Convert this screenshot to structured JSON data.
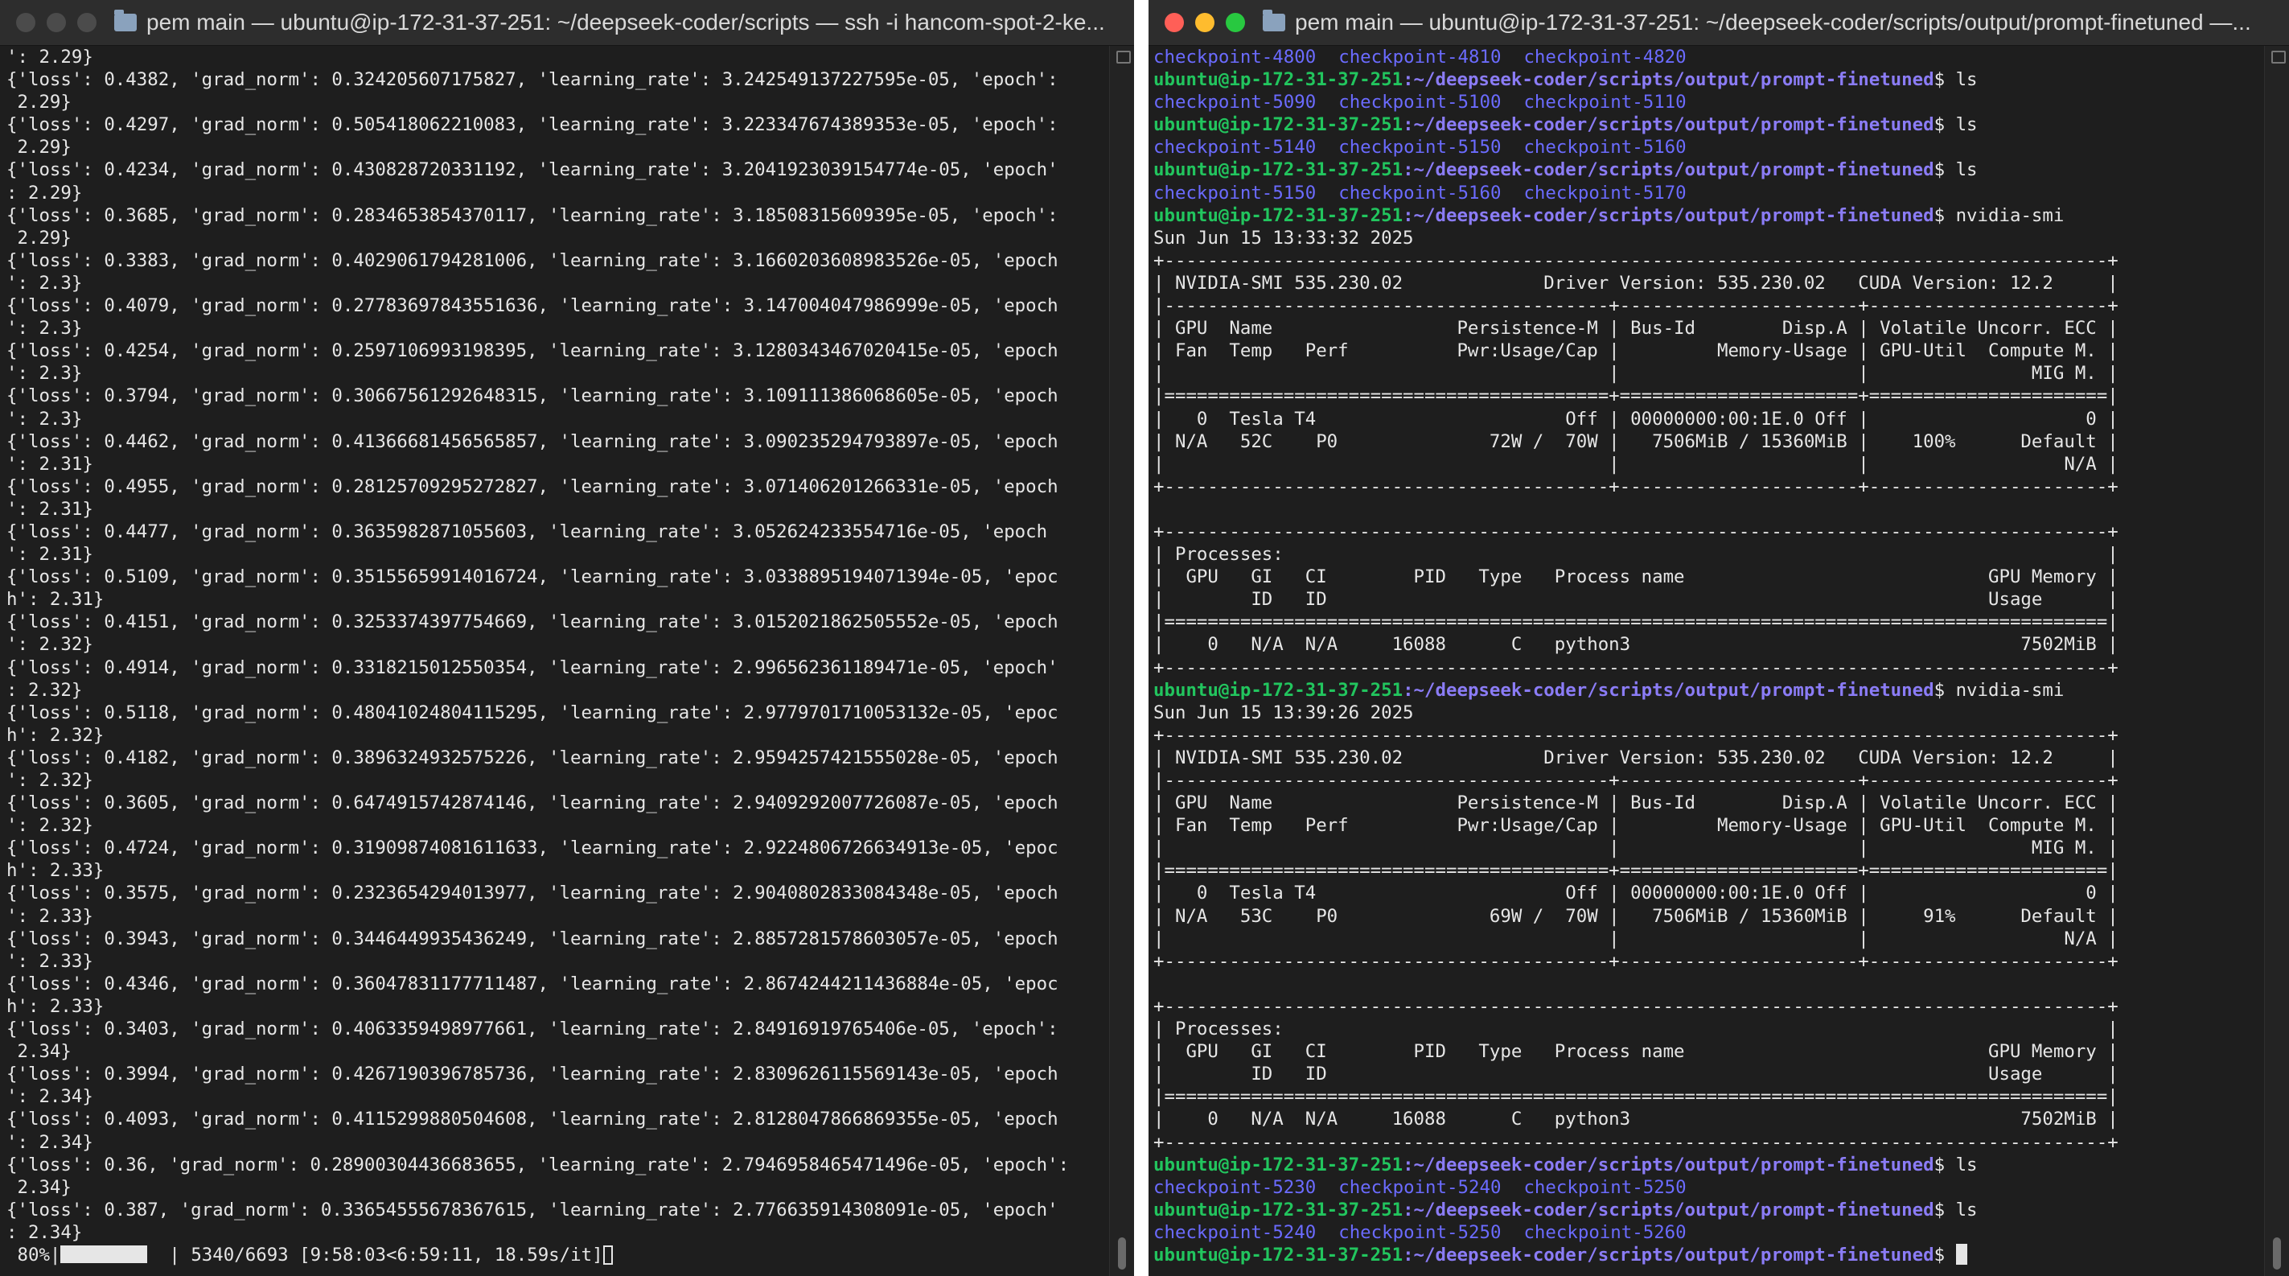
{
  "colors": {
    "close": "#ff5f57",
    "minimize": "#febc2e",
    "zoom": "#28c840",
    "prompt_user": "#22c55e",
    "prompt_path": "#8b7cf6",
    "checkpoint_dir": "#6b6bff"
  },
  "left_window": {
    "title": "pem main — ubuntu@ip-172-31-37-251: ~/deepseek-coder/scripts — ssh -i hancom-spot-2-ke...",
    "lines": [
      "': 2.29}",
      "{'loss': 0.4382, 'grad_norm': 0.324205607175827, 'learning_rate': 3.242549137227595e-05, 'epoch':",
      " 2.29}",
      "{'loss': 0.4297, 'grad_norm': 0.505418062210083, 'learning_rate': 3.223347674389353e-05, 'epoch':",
      " 2.29}",
      "{'loss': 0.4234, 'grad_norm': 0.430828720331192, 'learning_rate': 3.2041923039154774e-05, 'epoch'",
      ": 2.29}",
      "{'loss': 0.3685, 'grad_norm': 0.2834653854370117, 'learning_rate': 3.18508315609395e-05, 'epoch':",
      " 2.29}",
      "{'loss': 0.3383, 'grad_norm': 0.4029061794281006, 'learning_rate': 3.1660203608983526e-05, 'epoch",
      "': 2.3}",
      "{'loss': 0.4079, 'grad_norm': 0.27783697843551636, 'learning_rate': 3.147004047986999e-05, 'epoch",
      "': 2.3}",
      "{'loss': 0.4254, 'grad_norm': 0.2597106993198395, 'learning_rate': 3.1280343467020415e-05, 'epoch",
      "': 2.3}",
      "{'loss': 0.3794, 'grad_norm': 0.30667561292648315, 'learning_rate': 3.109111386068605e-05, 'epoch",
      "': 2.3}",
      "{'loss': 0.4462, 'grad_norm': 0.41366681456565857, 'learning_rate': 3.090235294793897e-05, 'epoch",
      "': 2.31}",
      "{'loss': 0.4955, 'grad_norm': 0.28125709295272827, 'learning_rate': 3.071406201266331e-05, 'epoch",
      "': 2.31}",
      "{'loss': 0.4477, 'grad_norm': 0.3635982871055603, 'learning_rate': 3.052624233554716e-05, 'epoch",
      "': 2.31}",
      "{'loss': 0.5109, 'grad_norm': 0.35155659914016724, 'learning_rate': 3.0338895194071394e-05, 'epoc",
      "h': 2.31}",
      "{'loss': 0.4151, 'grad_norm': 0.3253374397754669, 'learning_rate': 3.0152021862505552e-05, 'epoch",
      "': 2.32}",
      "{'loss': 0.4914, 'grad_norm': 0.3318215012550354, 'learning_rate': 2.996562361189471e-05, 'epoch'",
      ": 2.32}",
      "{'loss': 0.5118, 'grad_norm': 0.48041024804115295, 'learning_rate': 2.9779701710053132e-05, 'epoc",
      "h': 2.32}",
      "{'loss': 0.4182, 'grad_norm': 0.3896324932575226, 'learning_rate': 2.9594257421555028e-05, 'epoch",
      "': 2.32}",
      "{'loss': 0.3605, 'grad_norm': 0.6474915742874146, 'learning_rate': 2.9409292007726087e-05, 'epoch",
      "': 2.32}",
      "{'loss': 0.4724, 'grad_norm': 0.31909874081611633, 'learning_rate': 2.9224806726634913e-05, 'epoc",
      "h': 2.33}",
      "{'loss': 0.3575, 'grad_norm': 0.2323654294013977, 'learning_rate': 2.9040802833084348e-05, 'epoch",
      "': 2.33}",
      "{'loss': 0.3943, 'grad_norm': 0.3446449935436249, 'learning_rate': 2.8857281578603057e-05, 'epoch",
      "': 2.33}",
      "{'loss': 0.4346, 'grad_norm': 0.36047831177711487, 'learning_rate': 2.8674244211436884e-05, 'epoc",
      "h': 2.33}",
      "{'loss': 0.3403, 'grad_norm': 0.4063359498977661, 'learning_rate': 2.84916919765406e-05, 'epoch':",
      " 2.34}",
      "{'loss': 0.3994, 'grad_norm': 0.4267190396785736, 'learning_rate': 2.8309626115569143e-05, 'epoch",
      "': 2.34}",
      "{'loss': 0.4093, 'grad_norm': 0.4115299880504608, 'learning_rate': 2.8128047866869355e-05, 'epoch",
      "': 2.34}",
      "{'loss': 0.36, 'grad_norm': 0.28900304436683655, 'learning_rate': 2.7946958465471496e-05, 'epoch':",
      " 2.34}",
      "{'loss': 0.387, 'grad_norm': 0.33654555678367615, 'learning_rate': 2.776635914308091e-05, 'epoch'",
      ": 2.34}"
    ],
    "progress": {
      "percent_label": " 80%|",
      "fraction": 0.8,
      "rest": "  | 5340/6693 [9:58:03<6:59:11, 18.59s/it]"
    }
  },
  "right_window": {
    "title": "pem main — ubuntu@ip-172-31-37-251: ~/deepseek-coder/scripts/output/prompt-finetuned —...",
    "prompt_user": "ubuntu@ip-172-31-37-251",
    "prompt_path": ":~/deepseek-coder/scripts/output/prompt-finetuned",
    "lines": [
      {
        "kind": "ckpt",
        "items": [
          "checkpoint-4800",
          "checkpoint-4810",
          "checkpoint-4820"
        ]
      },
      {
        "kind": "prompt",
        "cmd": "$ ls"
      },
      {
        "kind": "ckpt",
        "items": [
          "checkpoint-5090",
          "checkpoint-5100",
          "checkpoint-5110"
        ]
      },
      {
        "kind": "prompt",
        "cmd": "$ ls"
      },
      {
        "kind": "ckpt",
        "items": [
          "checkpoint-5140",
          "checkpoint-5150",
          "checkpoint-5160"
        ]
      },
      {
        "kind": "prompt",
        "cmd": "$ ls"
      },
      {
        "kind": "ckpt",
        "items": [
          "checkpoint-5150",
          "checkpoint-5160",
          "checkpoint-5170"
        ]
      },
      {
        "kind": "prompt",
        "cmd": "$ nvidia-smi"
      },
      {
        "kind": "text",
        "text": "Sun Jun 15 13:33:32 2025"
      },
      {
        "kind": "text",
        "text": "+---------------------------------------------------------------------------------------+"
      },
      {
        "kind": "text",
        "text": "| NVIDIA-SMI 535.230.02             Driver Version: 535.230.02   CUDA Version: 12.2     |"
      },
      {
        "kind": "text",
        "text": "|-----------------------------------------+----------------------+----------------------+"
      },
      {
        "kind": "text",
        "text": "| GPU  Name                 Persistence-M | Bus-Id        Disp.A | Volatile Uncorr. ECC |"
      },
      {
        "kind": "text",
        "text": "| Fan  Temp   Perf          Pwr:Usage/Cap |         Memory-Usage | GPU-Util  Compute M. |"
      },
      {
        "kind": "text",
        "text": "|                                         |                      |               MIG M. |"
      },
      {
        "kind": "text",
        "text": "|=========================================+======================+======================|"
      },
      {
        "kind": "text",
        "text": "|   0  Tesla T4                       Off | 00000000:00:1E.0 Off |                    0 |"
      },
      {
        "kind": "text",
        "text": "| N/A   52C    P0              72W /  70W |   7506MiB / 15360MiB |    100%      Default |"
      },
      {
        "kind": "text",
        "text": "|                                         |                      |                  N/A |"
      },
      {
        "kind": "text",
        "text": "+-----------------------------------------+----------------------+----------------------+"
      },
      {
        "kind": "text",
        "text": ""
      },
      {
        "kind": "text",
        "text": "+---------------------------------------------------------------------------------------+"
      },
      {
        "kind": "text",
        "text": "| Processes:                                                                            |"
      },
      {
        "kind": "text",
        "text": "|  GPU   GI   CI        PID   Type   Process name                            GPU Memory |"
      },
      {
        "kind": "text",
        "text": "|        ID   ID                                                             Usage      |"
      },
      {
        "kind": "text",
        "text": "|=======================================================================================|"
      },
      {
        "kind": "text",
        "text": "|    0   N/A  N/A     16088      C   python3                                    7502MiB |"
      },
      {
        "kind": "text",
        "text": "+---------------------------------------------------------------------------------------+"
      },
      {
        "kind": "prompt",
        "cmd": "$ nvidia-smi"
      },
      {
        "kind": "text",
        "text": "Sun Jun 15 13:39:26 2025"
      },
      {
        "kind": "text",
        "text": "+---------------------------------------------------------------------------------------+"
      },
      {
        "kind": "text",
        "text": "| NVIDIA-SMI 535.230.02             Driver Version: 535.230.02   CUDA Version: 12.2     |"
      },
      {
        "kind": "text",
        "text": "|-----------------------------------------+----------------------+----------------------+"
      },
      {
        "kind": "text",
        "text": "| GPU  Name                 Persistence-M | Bus-Id        Disp.A | Volatile Uncorr. ECC |"
      },
      {
        "kind": "text",
        "text": "| Fan  Temp   Perf          Pwr:Usage/Cap |         Memory-Usage | GPU-Util  Compute M. |"
      },
      {
        "kind": "text",
        "text": "|                                         |                      |               MIG M. |"
      },
      {
        "kind": "text",
        "text": "|=========================================+======================+======================|"
      },
      {
        "kind": "text",
        "text": "|   0  Tesla T4                       Off | 00000000:00:1E.0 Off |                    0 |"
      },
      {
        "kind": "text",
        "text": "| N/A   53C    P0              69W /  70W |   7506MiB / 15360MiB |     91%      Default |"
      },
      {
        "kind": "text",
        "text": "|                                         |                      |                  N/A |"
      },
      {
        "kind": "text",
        "text": "+-----------------------------------------+----------------------+----------------------+"
      },
      {
        "kind": "text",
        "text": ""
      },
      {
        "kind": "text",
        "text": "+---------------------------------------------------------------------------------------+"
      },
      {
        "kind": "text",
        "text": "| Processes:                                                                            |"
      },
      {
        "kind": "text",
        "text": "|  GPU   GI   CI        PID   Type   Process name                            GPU Memory |"
      },
      {
        "kind": "text",
        "text": "|        ID   ID                                                             Usage      |"
      },
      {
        "kind": "text",
        "text": "|=======================================================================================|"
      },
      {
        "kind": "text",
        "text": "|    0   N/A  N/A     16088      C   python3                                    7502MiB |"
      },
      {
        "kind": "text",
        "text": "+---------------------------------------------------------------------------------------+"
      },
      {
        "kind": "prompt",
        "cmd": "$ ls"
      },
      {
        "kind": "ckpt",
        "items": [
          "checkpoint-5230",
          "checkpoint-5240",
          "checkpoint-5250"
        ]
      },
      {
        "kind": "prompt",
        "cmd": "$ ls"
      },
      {
        "kind": "ckpt",
        "items": [
          "checkpoint-5240",
          "checkpoint-5250",
          "checkpoint-5260"
        ]
      },
      {
        "kind": "prompt",
        "cmd": "$ ",
        "cursor": true
      }
    ]
  }
}
